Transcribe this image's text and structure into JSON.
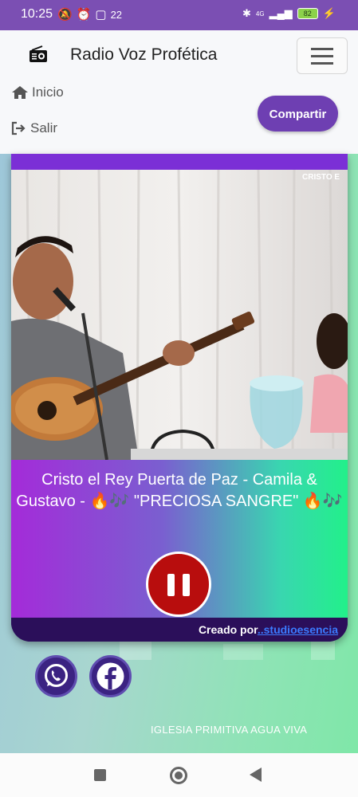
{
  "status_bar": {
    "time": "10:25",
    "left_icons": [
      "notification-off-icon",
      "alarm-icon",
      "app-icon",
      "temperature-icon",
      "app-icon"
    ],
    "temperature": "22",
    "network": "4G",
    "battery": "82"
  },
  "header": {
    "app_title": "Radio Voz Profética",
    "nav": {
      "inicio": "Inicio",
      "salir": "Salir"
    },
    "share_label": "Compartir"
  },
  "player": {
    "cover_overlay_text": "CRISTO E",
    "song_title": "Cristo el Rey Puerta de Paz - Camila & Gustavo - 🔥🎶 \"PRECIOSA SANGRE\" 🔥🎶",
    "state": "playing",
    "credits_prefix": "Creado por",
    "credits_link": "..studioesencia"
  },
  "social": [
    "whatsapp-icon",
    "facebook-icon"
  ],
  "footer": {
    "text": "IGLESIA PRIMITIVA AGUA VIVA"
  },
  "colors": {
    "brand": "#6e3fb2",
    "pause": "#b80d0d",
    "status_bar": "#7b4fb3"
  }
}
